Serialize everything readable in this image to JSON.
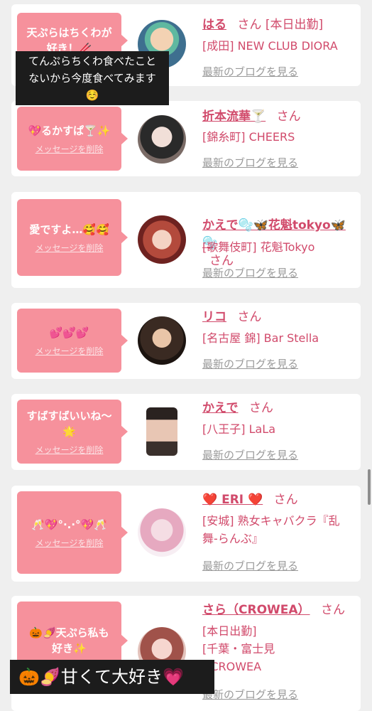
{
  "cards": [
    {
      "message": "天ぷらはちくわが\n好き！🥢",
      "delete_label": "",
      "name": "はる",
      "san": "さん",
      "status": "[本日出勤]",
      "shop": "[成田] NEW CLUB DIORA",
      "blog_link": "最新のブログを見る"
    },
    {
      "message": "💖るかすぱ🍸✨",
      "delete_label": "メッセージを削除",
      "name": "折本流華🍸",
      "san": "さん",
      "status": "",
      "shop": "[錦糸町] CHEERS",
      "blog_link": "最新のブログを見る"
    },
    {
      "message": "愛ですよ…🥰🥰",
      "delete_label": "メッセージを削除",
      "name": "かえで🫧🦋花魁tokyo🦋\n🫧",
      "san": "さん",
      "status": "",
      "shop": "[歌舞伎町] 花魁Tokyo",
      "blog_link": "最新のブログを見る"
    },
    {
      "message": "💕💕💕",
      "delete_label": "メッセージを削除",
      "name": "リコ",
      "san": "さん",
      "status": "",
      "shop": "[名古屋 錦] Bar Stella",
      "blog_link": "最新のブログを見る"
    },
    {
      "message": "すばすばいいね〜\n🌟",
      "delete_label": "メッセージを削除",
      "name": "かえで",
      "san": "さん",
      "status": "",
      "shop": "[八王子] LaLa",
      "blog_link": "最新のブログを見る"
    },
    {
      "message": "🥂💖°·.·°💖🥂",
      "delete_label": "メッセージを削除",
      "name": "❤️ ERI ❤️",
      "san": "さん",
      "status": "",
      "shop": "[安城] 熟女キャバクラ『乱\n舞-らんぶ』",
      "blog_link": "最新のブログを見る"
    },
    {
      "message": "🎃🍠天ぷら私も\n好き✨",
      "delete_label": "",
      "name": "さら（CROWEA）",
      "san": "さん",
      "status": "",
      "shop": "[本日出勤]\n[千葉・富士見\n] CROWEA",
      "blog_link": "最新のブログを見る"
    }
  ],
  "overlays": {
    "top_text": "てんぷらちくわ食べたこと\nないから今度食べてみます\n☺️",
    "bottom_text": "🎃🍠甘くて大好き💗"
  },
  "colors": {
    "bubble": "#f6919c",
    "name": "#d14a6b",
    "link": "#9a9a9a",
    "background": "#efefef"
  }
}
